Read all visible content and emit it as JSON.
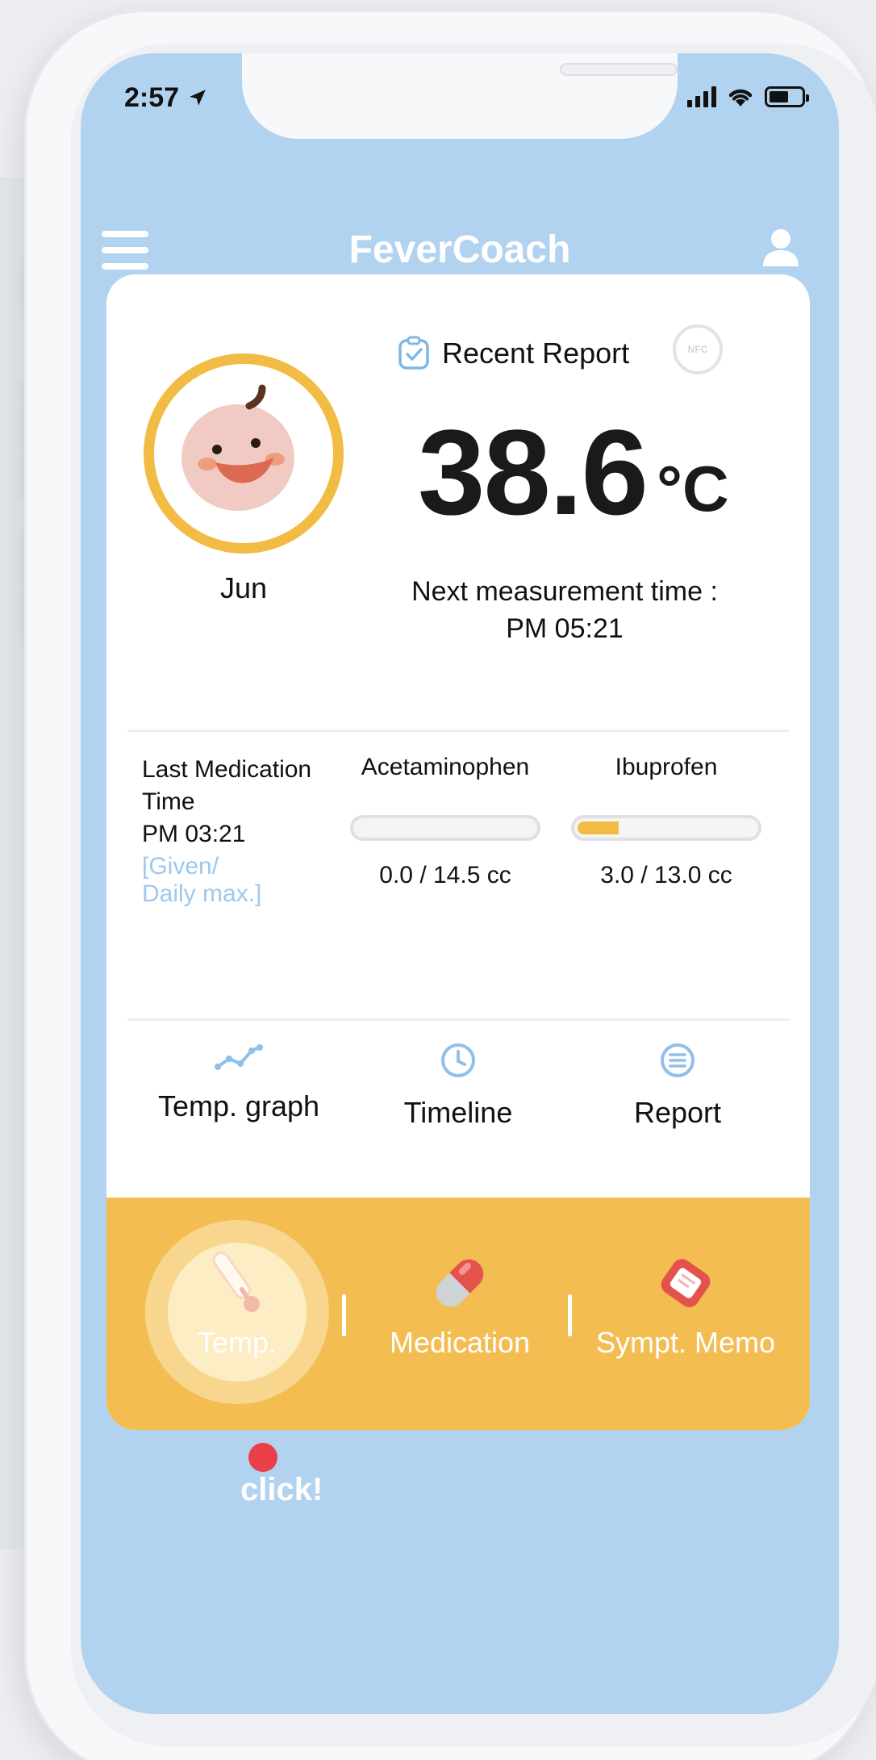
{
  "status_bar": {
    "time": "2:57"
  },
  "header": {
    "title": "FeverCoach"
  },
  "profile": {
    "name": "Jun"
  },
  "report": {
    "recent_label": "Recent Report",
    "nfc": "NFC",
    "temperature": "38.6",
    "unit": "°C",
    "next_label": "Next measurement time :",
    "next_time": "PM 05:21"
  },
  "medication": {
    "label_line1": "Last Medication",
    "label_line2": "Time",
    "time": "PM 03:21",
    "note_line1": "[Given/",
    "note_line2": "Daily max.]",
    "items": [
      {
        "name": "Acetaminophen",
        "amount": "0.0 / 14.5 cc",
        "given": 0.0,
        "max": 14.5
      },
      {
        "name": "Ibuprofen",
        "amount": "3.0 / 13.0 cc",
        "given": 3.0,
        "max": 13.0
      }
    ]
  },
  "nav": [
    {
      "label": "Temp. graph",
      "icon": "graph-icon"
    },
    {
      "label": "Timeline",
      "icon": "clock-icon"
    },
    {
      "label": "Report",
      "icon": "list-icon"
    }
  ],
  "actions": [
    {
      "label": "Temp.",
      "icon": "thermometer-icon"
    },
    {
      "label": "Medication",
      "icon": "pill-icon"
    },
    {
      "label": "Sympt. Memo",
      "icon": "memo-icon"
    }
  ],
  "hint": {
    "label": "click!"
  },
  "colors": {
    "screen_bg": "#b2d3ef",
    "accent_yellow": "#f2bb43",
    "action_bar": "#f3bd52",
    "light_blue": "#9ec8ec",
    "click_red": "#ea3f47"
  }
}
